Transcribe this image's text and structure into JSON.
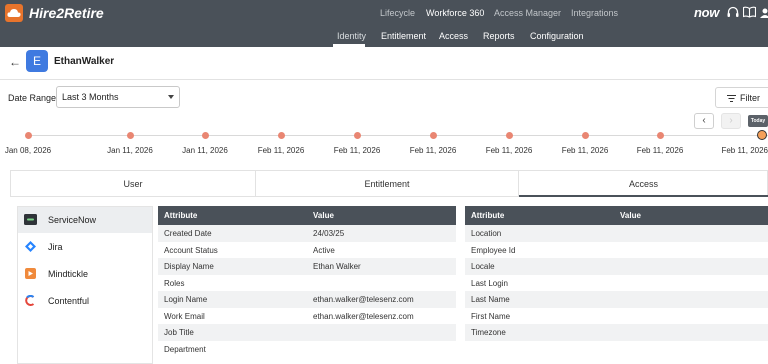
{
  "app": {
    "logo_text": "Hire2Retire",
    "brand": "now"
  },
  "topnav": [
    "Lifecycle",
    "Workforce 360",
    "Access Manager",
    "Integrations"
  ],
  "subtabs": [
    "Identity",
    "Entitlement",
    "Access",
    "Reports",
    "Configuration"
  ],
  "user": {
    "initial": "E",
    "name": "EthanWalker"
  },
  "date_range": {
    "label": "Date Range",
    "value": "Last 3 Months"
  },
  "filter_label": "Filter",
  "today_label": "Today",
  "timeline": [
    "Jan 08, 2026",
    "Jan 11, 2026",
    "Jan 11, 2026",
    "Feb 11, 2026",
    "Feb 11, 2026",
    "Feb 11, 2026",
    "Feb 11, 2026",
    "Feb 11, 2026",
    "Feb 11, 2026",
    "Feb 11, 2026"
  ],
  "tabs": [
    "User",
    "Entitlement",
    "Access"
  ],
  "apps": [
    "ServiceNow",
    "Jira",
    "Mindtickle",
    "Contentful"
  ],
  "left_table": {
    "headers": [
      "Attribute",
      "Value"
    ],
    "rows": [
      [
        "Created Date",
        "24/03/25"
      ],
      [
        "Account Status",
        "Active"
      ],
      [
        "Display Name",
        "Ethan Walker"
      ],
      [
        "Roles",
        ""
      ],
      [
        "Login Name",
        "ethan.walker@telesenz.com"
      ],
      [
        "Work Email",
        "ethan.walker@telesenz.com"
      ],
      [
        "Job Title",
        ""
      ],
      [
        "Department",
        ""
      ]
    ]
  },
  "right_table": {
    "headers": [
      "Attribute",
      "Value"
    ],
    "rows": [
      [
        "Location",
        ""
      ],
      [
        "Employee Id",
        ""
      ],
      [
        "Locale",
        ""
      ],
      [
        "Last Login",
        ""
      ],
      [
        "Last Name",
        ""
      ],
      [
        "First Name",
        ""
      ],
      [
        "Timezone",
        ""
      ]
    ]
  },
  "colors": {
    "header_bg": "#4a5159",
    "accent_orange": "#e8742c",
    "avatar_blue": "#3f7ae0",
    "timeline_dot": "#e98672"
  }
}
